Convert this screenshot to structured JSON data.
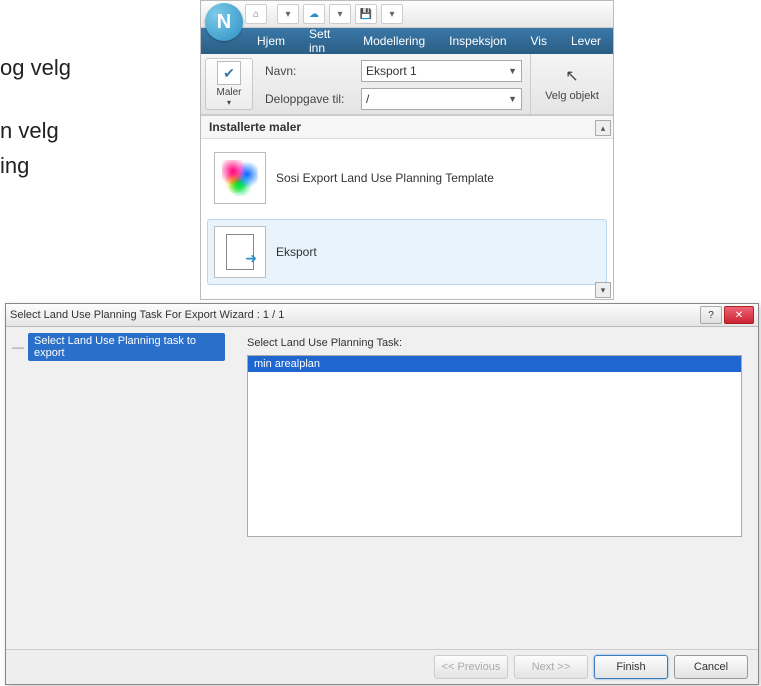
{
  "page_text": {
    "line1": " og velg",
    "line2": "n velg",
    "line3": "ing"
  },
  "app": {
    "logo_letter": "N",
    "titlebar_icons": {
      "home": "⌂",
      "separator": "·",
      "cloud": "☁",
      "dropdown": "▾",
      "save": "💾"
    },
    "ribbon": {
      "tabs": [
        "Hjem",
        "Sett inn",
        "Modellering",
        "Inspeksjon",
        "Vis",
        "Lever"
      ]
    },
    "maler": {
      "label": "Maler",
      "dropdown_arrow": "▾",
      "check": "✔"
    },
    "form": {
      "name_label": "Navn:",
      "name_value": "Eksport 1",
      "subtask_label": "Deloppgave til:",
      "subtask_value": "/"
    },
    "side": {
      "icon": "↖",
      "label": "Velg objekt"
    },
    "templates": {
      "header": "Installerte maler",
      "items": [
        {
          "label": "Sosi Export Land Use Planning Template",
          "selected": false,
          "thumb": "colorful"
        },
        {
          "label": "Eksport",
          "selected": true,
          "thumb": "doc"
        }
      ],
      "scroll_up": "▴",
      "scroll_down": "▾"
    }
  },
  "wizard": {
    "title": "Select Land Use Planning Task For Export Wizard : 1 / 1",
    "help": "?",
    "close": "✕",
    "nav": {
      "dash": "—",
      "step": "Select Land Use Planning task to export"
    },
    "content": {
      "label": "Select Land Use Planning Task:",
      "tasks": [
        {
          "name": "min arealplan",
          "selected": true
        }
      ]
    },
    "footer": {
      "previous": "<< Previous",
      "next": "Next >>",
      "finish": "Finish",
      "cancel": "Cancel"
    }
  }
}
